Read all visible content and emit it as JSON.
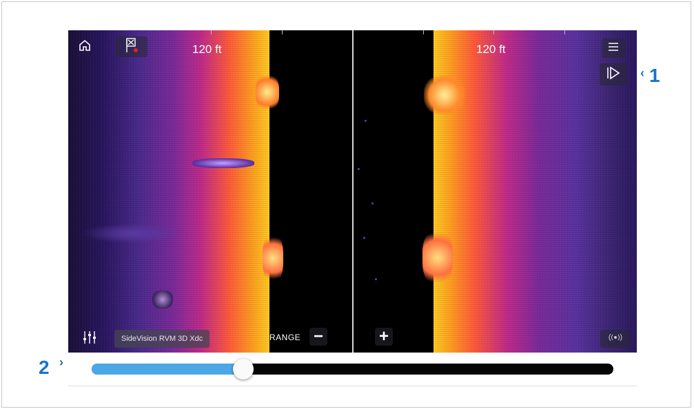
{
  "screen": {
    "left_scale": "120 ft",
    "right_scale": "120 ft",
    "range_label": "RANGE",
    "range_minus": "−",
    "range_plus": "+",
    "device_name": "SideVision RVM 3D Xdc",
    "icons": {
      "home": "home-icon",
      "waypoint": "waypoint-flag-icon",
      "menu": "hamburger-menu-icon",
      "play": "play-icon",
      "settings": "sliders-icon",
      "transducer": "transducer-signal-icon"
    }
  },
  "history_slider": {
    "position_fraction": 0.29,
    "fill_color": "#4da6e6",
    "track_color": "#050505"
  },
  "callouts": {
    "one": "1",
    "two": "2"
  }
}
